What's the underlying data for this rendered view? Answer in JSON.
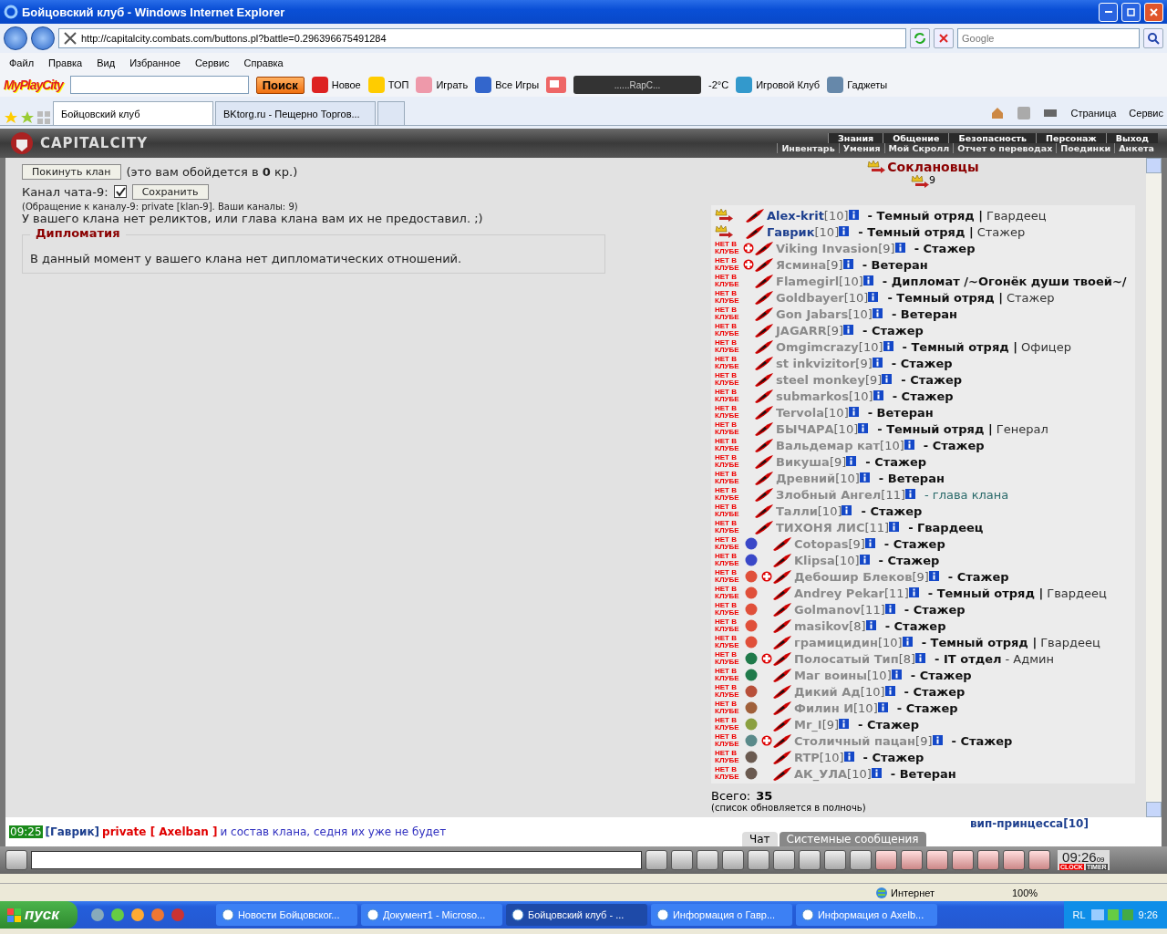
{
  "browser": {
    "title": "Бойцовский клуб - Windows Internet Explorer",
    "address": "http://capitalcity.combats.com/buttons.pl?battle=0.296396675491284",
    "search_placeholder": "Google",
    "menu": [
      "Файл",
      "Правка",
      "Вид",
      "Избранное",
      "Сервис",
      "Справка"
    ],
    "toolbar": {
      "logo": "MyPlayCity",
      "search_button": "Поиск",
      "items": [
        "Новое",
        "ТОП",
        "Играть",
        "Все Игры"
      ],
      "player": "......RapC...",
      "weather": "-2°C",
      "items2": [
        "Игровой Клуб",
        "Гаджеты"
      ]
    },
    "tabs": [
      {
        "label": "Бойцовский клуб",
        "selected": true
      },
      {
        "label": "BKtorg.ru - Пещерно Торгов...",
        "selected": false
      }
    ],
    "commands": [
      "Страница",
      "Сервис"
    ]
  },
  "game": {
    "logo": "CAPITALCITY",
    "nav_top": [
      "Знания",
      "Общение",
      "Безопасность",
      "Персонаж",
      "Выход"
    ],
    "nav_bottom": [
      "Инвентарь",
      "Умения",
      "Мой Скролл",
      "Отчет о переводах",
      "Поединки",
      "Анкета"
    ]
  },
  "clan": {
    "leave_button": "Покинуть клан",
    "leave_note": "(это вам обойдется в **0** кр.)",
    "channel_label": "Канал чата-9:",
    "channel_checked": true,
    "save_button": "Сохранить",
    "channel_note": "(Обращение к каналу-9: private [klan-9]. Ваши каналы: 9)",
    "relics_note": "У вашего клана нет реликтов, или глава клана вам их не предоставил. ;)",
    "diplomacy": {
      "legend": "Дипломатия",
      "text": "В данный момент у вашего клана нет дипломатических отношений."
    }
  },
  "members_panel": {
    "title": "Соклановцы",
    "online_count": "9",
    "members": [
      {
        "name": "Alex-krit",
        "level": "[10]",
        "online": true,
        "cross": false,
        "kind": "member",
        "role": "- Темный отряд |",
        "title": "Гвардеец"
      },
      {
        "name": "Гаврик",
        "level": "[10]",
        "online": true,
        "cross": false,
        "kind": "member",
        "role": "- Темный отряд |",
        "title": "Стажер"
      },
      {
        "name": "Viking Invasion",
        "level": "[9]",
        "online": false,
        "badge": "НЕТ В КЛУБЕ",
        "cross": true,
        "kind": "member",
        "role": "- Стажер"
      },
      {
        "name": "Ясмина",
        "level": "[9]",
        "online": false,
        "badge": "НЕТ В КЛУБЕ",
        "cross": true,
        "kind": "member",
        "role": "- Ветеран"
      },
      {
        "name": "Flamegirl",
        "level": "[10]",
        "online": false,
        "badge": "НЕТ В КЛУБЕ",
        "cross": false,
        "kind": "member",
        "role": "- Дипломат /~Огонёк души твоей~/"
      },
      {
        "name": "Goldbayer",
        "level": "[10]",
        "online": false,
        "badge": "НЕТ В КЛУБЕ",
        "cross": false,
        "kind": "member",
        "role": "- Темный отряд |",
        "title": "Стажер"
      },
      {
        "name": "Gon Jabars",
        "level": "[10]",
        "online": false,
        "badge": "НЕТ В КЛУБЕ",
        "cross": false,
        "kind": "member",
        "role": "- Ветеран"
      },
      {
        "name": "JAGARR",
        "level": "[9]",
        "online": false,
        "badge": "НЕТ В КЛУБЕ",
        "cross": false,
        "kind": "member",
        "role": "- Стажер"
      },
      {
        "name": "Omgimcrazy",
        "level": "[10]",
        "online": false,
        "badge": "НЕТ В КЛУБЕ",
        "cross": false,
        "kind": "member",
        "role": "- Темный отряд |",
        "title": "Офицер"
      },
      {
        "name": "st inkvizitor",
        "level": "[9]",
        "online": false,
        "badge": "НЕТ В КЛУБЕ",
        "cross": false,
        "kind": "member",
        "role": "- Стажер"
      },
      {
        "name": "steel monkey",
        "level": "[9]",
        "online": false,
        "badge": "НЕТ В КЛУБЕ",
        "cross": false,
        "kind": "member",
        "role": "- Стажер"
      },
      {
        "name": "submarkos",
        "level": "[10]",
        "online": false,
        "badge": "НЕТ В КЛУБЕ",
        "cross": false,
        "kind": "member",
        "role": "- Стажер"
      },
      {
        "name": "Tervola",
        "level": "[10]",
        "online": false,
        "badge": "НЕТ В КЛУБЕ",
        "cross": false,
        "kind": "member",
        "role": "- Ветеран"
      },
      {
        "name": "БЫЧАРА",
        "level": "[10]",
        "online": false,
        "badge": "НЕТ В КЛУБЕ",
        "cross": false,
        "kind": "member",
        "role": "- Темный отряд |",
        "title": "Генерал"
      },
      {
        "name": "Вальдемар кат",
        "level": "[10]",
        "online": false,
        "badge": "НЕТ В КЛУБЕ",
        "cross": false,
        "kind": "member",
        "role": "- Стажер"
      },
      {
        "name": "Викуша",
        "level": "[9]",
        "online": false,
        "badge": "НЕТ В КЛУБЕ",
        "cross": false,
        "kind": "member",
        "role": "- Стажер"
      },
      {
        "name": "Древний",
        "level": "[10]",
        "online": false,
        "badge": "НЕТ В КЛУБЕ",
        "cross": false,
        "kind": "member",
        "role": "- Ветеран"
      },
      {
        "name": "Злобный Ангел",
        "level": "[11]",
        "online": false,
        "badge": "НЕТ В КЛУБЕ",
        "cross": false,
        "kind": "head",
        "role": "- глава клана"
      },
      {
        "name": "Талли",
        "level": "[10]",
        "online": false,
        "badge": "НЕТ В КЛУБЕ",
        "cross": false,
        "kind": "member",
        "role": "- Стажер"
      },
      {
        "name": "ТИХОНЯ ЛИС",
        "level": "[11]",
        "online": false,
        "badge": "НЕТ В КЛУБЕ",
        "cross": false,
        "kind": "member",
        "role": "- Гвардеец"
      },
      {
        "name": "Cotopas",
        "level": "[9]",
        "online": false,
        "badge": "НЕТ В КЛУБЕ",
        "color": "#3a48c8",
        "cross": false,
        "kind": "member",
        "role": "- Стажер"
      },
      {
        "name": "Klipsa",
        "level": "[10]",
        "online": false,
        "badge": "НЕТ В КЛУБЕ",
        "color": "#3a48c8",
        "cross": false,
        "kind": "member",
        "role": "- Стажер"
      },
      {
        "name": "Дебошир Блеков",
        "level": "[9]",
        "online": false,
        "badge": "НЕТ В КЛУБЕ",
        "color": "#e0503a",
        "cross": true,
        "kind": "member",
        "role": "- Стажер"
      },
      {
        "name": "Andrey Pekar",
        "level": "[11]",
        "online": false,
        "badge": "НЕТ В КЛУБЕ",
        "color": "#e0503a",
        "cross": false,
        "kind": "member",
        "role": "- Темный отряд |",
        "title": "Гвардеец"
      },
      {
        "name": "Golmanov",
        "level": "[11]",
        "online": false,
        "badge": "НЕТ В КЛУБЕ",
        "color": "#e0503a",
        "cross": false,
        "kind": "member",
        "role": "- Стажер"
      },
      {
        "name": "masikov",
        "level": "[8]",
        "online": false,
        "badge": "НЕТ В КЛУБЕ",
        "color": "#e0503a",
        "cross": false,
        "kind": "member",
        "role": "- Стажер"
      },
      {
        "name": "грамицидин",
        "level": "[10]",
        "online": false,
        "badge": "НЕТ В КЛУБЕ",
        "color": "#e0503a",
        "cross": false,
        "kind": "member",
        "role": "- Темный отряд |",
        "title": "Гвардеец"
      },
      {
        "name": "Полосатый Тип",
        "level": "[8]",
        "online": false,
        "badge": "НЕТ В КЛУБЕ",
        "color": "#1f7a4a",
        "cross": true,
        "kind": "member",
        "role": "- IT отдел",
        "title": "- Админ"
      },
      {
        "name": "Маг воины",
        "level": "[10]",
        "online": false,
        "badge": "НЕТ В КЛУБЕ",
        "color": "#1f7a4a",
        "cross": false,
        "kind": "member",
        "role": "- Стажер"
      },
      {
        "name": "Дикий Ад",
        "level": "[10]",
        "online": false,
        "badge": "НЕТ В КЛУБЕ",
        "color": "#b8503a",
        "cross": false,
        "kind": "member",
        "role": "- Стажер"
      },
      {
        "name": "Филин И",
        "level": "[10]",
        "online": false,
        "badge": "НЕТ В КЛУБЕ",
        "color": "#a0603a",
        "cross": false,
        "kind": "member",
        "role": "- Стажер"
      },
      {
        "name": "Mr_I",
        "level": "[9]",
        "online": false,
        "badge": "НЕТ В КЛУБЕ",
        "color": "#8aa040",
        "cross": false,
        "kind": "member",
        "role": "- Стажер"
      },
      {
        "name": "Столичный пацан",
        "level": "[9]",
        "online": false,
        "badge": "НЕТ В КЛУБЕ",
        "color": "#5a8a8a",
        "cross": true,
        "kind": "member",
        "role": "- Стажер"
      },
      {
        "name": "RTP",
        "level": "[10]",
        "online": false,
        "badge": "НЕТ В КЛУБЕ",
        "color": "#6a5a50",
        "cross": false,
        "kind": "member",
        "role": "- Стажер"
      },
      {
        "name": "АК_УЛА",
        "level": "[10]",
        "online": false,
        "badge": "НЕТ В КЛУБЕ",
        "color": "#6a5a50",
        "cross": false,
        "kind": "member",
        "role": "- Ветеран"
      }
    ],
    "total_label": "Всего:",
    "total": "35",
    "update_note": "(список обновляется в полночь)"
  },
  "chat": {
    "lines": [
      {
        "time": "09:25",
        "sender": "[Гаврик]",
        "private": "private [ Axelban ]",
        "text": "и состав клана, седня их уже не будет"
      }
    ],
    "tabs": [
      {
        "label": "Чат",
        "selected": true
      },
      {
        "label": "Системные сообщения",
        "selected": false
      }
    ],
    "users": [
      "вип-принцесса[10]"
    ],
    "clock": "09:26",
    "clock_seconds": "09",
    "clock_label": "CLOCK",
    "timer_label": "TIMER"
  },
  "status_bar": {
    "zone": "Интернет",
    "zoom": "100%"
  },
  "taskbar": {
    "start": "пуск",
    "tasks": [
      {
        "label": "Новости Бойцовског...",
        "selected": false
      },
      {
        "label": "Документ1 - Microso...",
        "selected": false
      },
      {
        "label": "Бойцовский клуб - ...",
        "selected": true
      },
      {
        "label": "Информация о Гавр...",
        "selected": false
      },
      {
        "label": "Информация о Axelb...",
        "selected": false
      }
    ],
    "language": "RL",
    "time": "9:26"
  }
}
